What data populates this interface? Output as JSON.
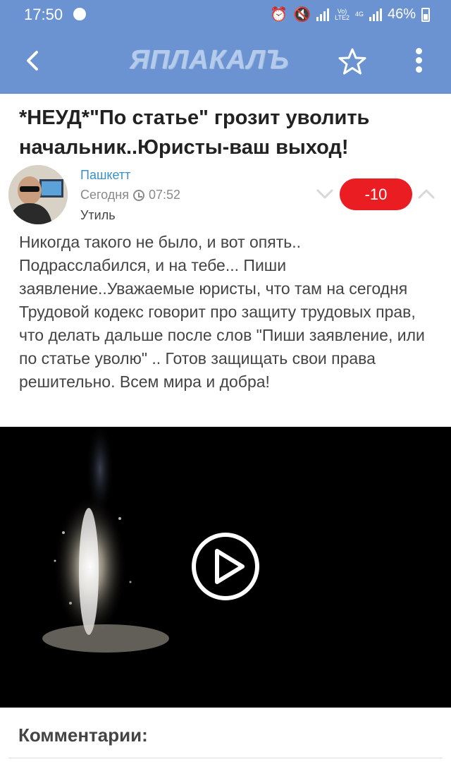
{
  "status_bar": {
    "time": "17:50",
    "network_top": "Vo)",
    "network_bottom": "LTE2",
    "network_type": "4G",
    "battery": "46%"
  },
  "app_bar": {
    "logo": "ЯПЛАКАЛЪ",
    "back_icon": "back-arrow-icon",
    "favorite_icon": "star-icon",
    "menu_icon": "more-vertical-icon"
  },
  "post": {
    "title": "*НЕУД*\"По статье\" грозит уволить начальник..Юристы-ваш выход!",
    "author": "Пашкетт",
    "date": "Сегодня",
    "time": "07:52",
    "category": "Утиль",
    "rating": "-10",
    "text": "Никогда такого не было, и вот опять.. Подрасслабился, и на тебе... Пиши заявление..Уважаемые юристы, что там на сегодня Трудовой кодекс говорит про защиту трудовых прав, что делать дальше после слов \"Пиши заявление, или по статье уволю\" .. Готов защищать свои права решительно. Всем мира и добра!"
  },
  "comments": {
    "title": "Комментарии:"
  },
  "colors": {
    "header_blue": "#6b93d1",
    "rating_red": "#ea1d22",
    "author_blue": "#3a8fc8"
  }
}
